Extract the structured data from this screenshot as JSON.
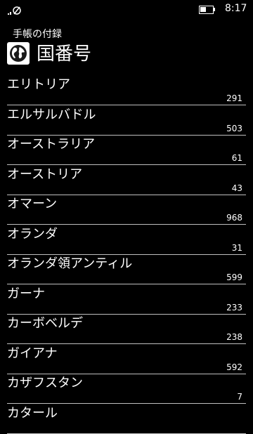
{
  "status": {
    "time": "8:17",
    "battery_level": 0.55,
    "signal_icon": "no-signal-icon"
  },
  "header": {
    "app_name": "手帳の付録",
    "page_title": "国番号",
    "icon": "globe-icon"
  },
  "items": [
    {
      "name": "エリトリア",
      "code": "291"
    },
    {
      "name": "エルサルバドル",
      "code": "503"
    },
    {
      "name": "オーストラリア",
      "code": "61"
    },
    {
      "name": "オーストリア",
      "code": "43"
    },
    {
      "name": "オマーン",
      "code": "968"
    },
    {
      "name": "オランダ",
      "code": "31"
    },
    {
      "name": "オランダ領アンティル",
      "code": "599"
    },
    {
      "name": "ガーナ",
      "code": "233"
    },
    {
      "name": "カーボベルデ",
      "code": "238"
    },
    {
      "name": "ガイアナ",
      "code": "592"
    },
    {
      "name": "カザフスタン",
      "code": "7"
    },
    {
      "name": "カタール",
      "code": ""
    }
  ]
}
